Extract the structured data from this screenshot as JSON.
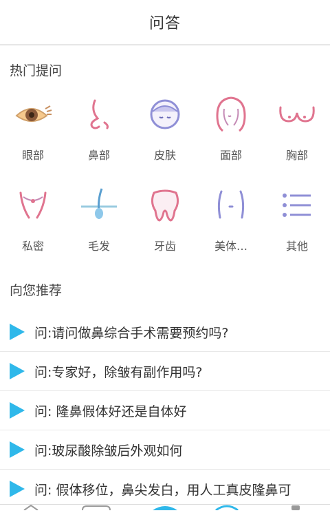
{
  "header": {
    "title": "问答"
  },
  "hot": {
    "title": "热门提问",
    "items": [
      {
        "label": "眼部",
        "icon": "eye-icon"
      },
      {
        "label": "鼻部",
        "icon": "nose-icon"
      },
      {
        "label": "皮肤",
        "icon": "face-skin-icon"
      },
      {
        "label": "面部",
        "icon": "face-hair-icon"
      },
      {
        "label": "胸部",
        "icon": "chest-icon"
      },
      {
        "label": "私密",
        "icon": "private-icon"
      },
      {
        "label": "毛发",
        "icon": "hair-icon"
      },
      {
        "label": "牙齿",
        "icon": "tooth-icon"
      },
      {
        "label": "美体…",
        "icon": "body-icon"
      },
      {
        "label": "其他",
        "icon": "list-icon"
      }
    ]
  },
  "recommend": {
    "title": "向您推荐",
    "questions": [
      "问:请问做鼻综合手术需要预约吗?",
      "问:专家好，除皱有副作用吗?",
      "问: 隆鼻假体好还是自体好",
      "问:玻尿酸除皱后外观如何",
      "问: 假体移位，鼻尖发白，用人工真皮隆鼻可"
    ]
  },
  "colors": {
    "accent": "#2fb8ea",
    "pink": "#e0748f",
    "purple": "#8f8fd6"
  }
}
